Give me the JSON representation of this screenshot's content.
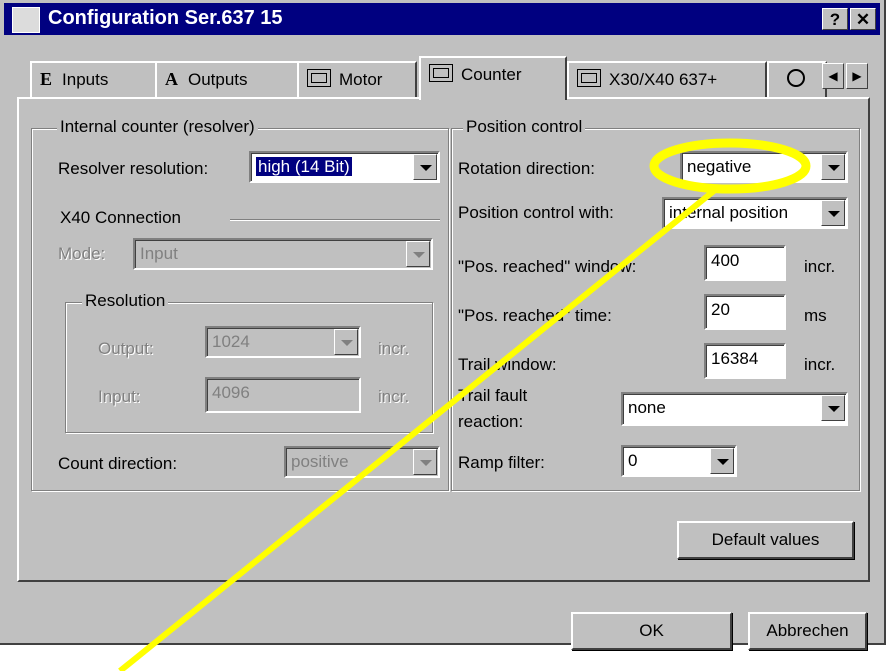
{
  "window": {
    "title": "Configuration Ser.637 15",
    "help_label": "?",
    "close_label": "✕"
  },
  "tabs": [
    {
      "icon_letter": "E",
      "label": "Inputs"
    },
    {
      "icon_letter": "A",
      "label": "Outputs"
    },
    {
      "label": "Motor"
    },
    {
      "label": "Counter",
      "active": true
    },
    {
      "label": "X30/X40 637+"
    }
  ],
  "internal_counter": {
    "title": "Internal counter (resolver)",
    "resolver_label": "Resolver resolution:",
    "resolver_value": "high (14 Bit)"
  },
  "x40": {
    "title": "X40 Connection",
    "mode_label": "Mode:",
    "mode_value": "Input",
    "resolution_title": "Resolution",
    "output_label": "Output:",
    "output_value": "1024",
    "output_unit": "incr.",
    "input_label": "Input:",
    "input_value": "4096",
    "input_unit": "incr.",
    "count_dir_label": "Count direction:",
    "count_dir_value": "positive"
  },
  "position_control": {
    "title": "Position control",
    "rotation_label": "Rotation direction:",
    "rotation_value": "negative",
    "pc_with_label": "Position control with:",
    "pc_with_value": "internal position",
    "window_label": "\"Pos. reached\" window:",
    "window_value": "400",
    "window_unit": "incr.",
    "time_label": "\"Pos. reached\" time:",
    "time_value": "20",
    "time_unit": "ms",
    "trail_label": "Trail window:",
    "trail_value": "16384",
    "trail_unit": "incr.",
    "fault_label_1": "Trail fault",
    "fault_label_2": "reaction:",
    "fault_value": "none",
    "ramp_label": "Ramp filter:",
    "ramp_value": "0"
  },
  "buttons": {
    "defaults": "Default values",
    "ok": "OK",
    "cancel": "Abbrechen"
  },
  "annotation": {
    "color": "#ffff00"
  }
}
